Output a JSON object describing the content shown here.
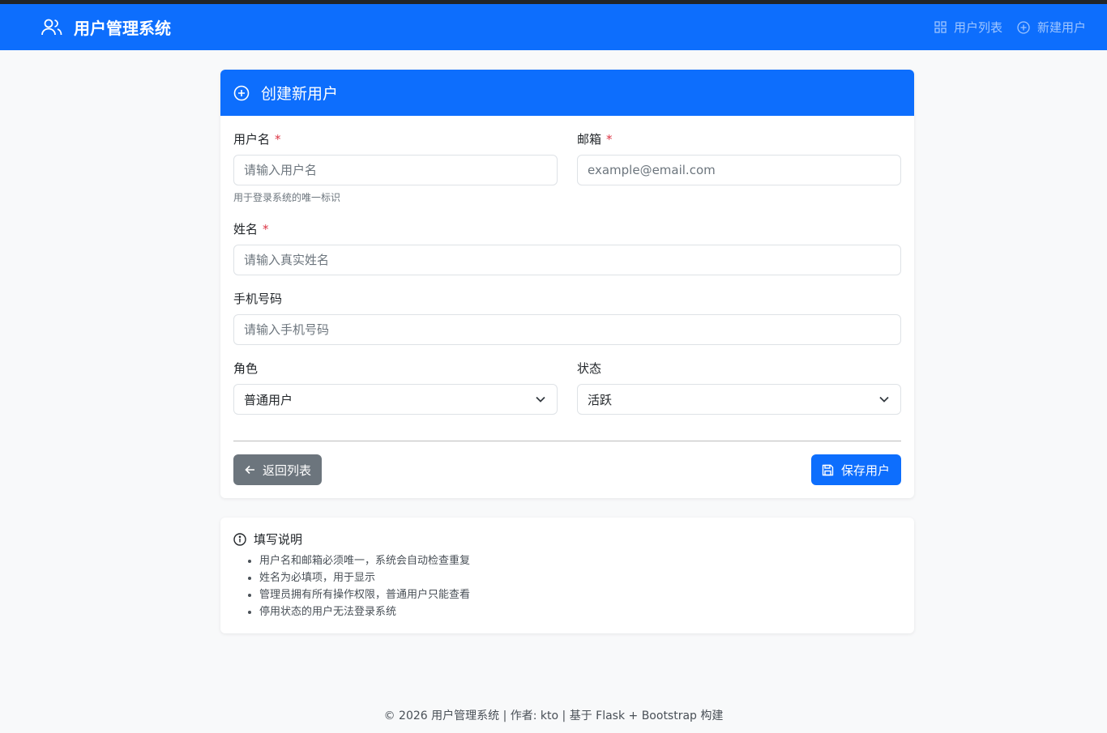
{
  "navbar": {
    "brand": "用户管理系统",
    "links": [
      {
        "label": "用户列表",
        "icon": "grid-icon"
      },
      {
        "label": "新建用户",
        "icon": "plus-circle-icon"
      }
    ]
  },
  "form_card": {
    "title": "创建新用户",
    "fields": {
      "username": {
        "label": "用户名",
        "required_mark": "*",
        "placeholder": "请输入用户名",
        "help": "用于登录系统的唯一标识"
      },
      "email": {
        "label": "邮箱",
        "required_mark": "*",
        "placeholder": "example@email.com"
      },
      "fullname": {
        "label": "姓名",
        "required_mark": "*",
        "placeholder": "请输入真实姓名"
      },
      "phone": {
        "label": "手机号码",
        "placeholder": "请输入手机号码"
      },
      "role": {
        "label": "角色",
        "value": "普通用户"
      },
      "status": {
        "label": "状态",
        "value": "活跃"
      }
    },
    "back_button": "返回列表",
    "save_button": "保存用户"
  },
  "info_card": {
    "title": "填写说明",
    "items": [
      "用户名和邮箱必须唯一，系统会自动检查重复",
      "姓名为必填项，用于显示",
      "管理员拥有所有操作权限，普通用户只能查看",
      "停用状态的用户无法登录系统"
    ]
  },
  "footer": "© 2026 用户管理系统 | 作者: kto | 基于 Flask + Bootstrap 构建",
  "colors": {
    "primary": "#0d6efd",
    "secondary": "#6c757d",
    "danger": "#dc3545"
  }
}
